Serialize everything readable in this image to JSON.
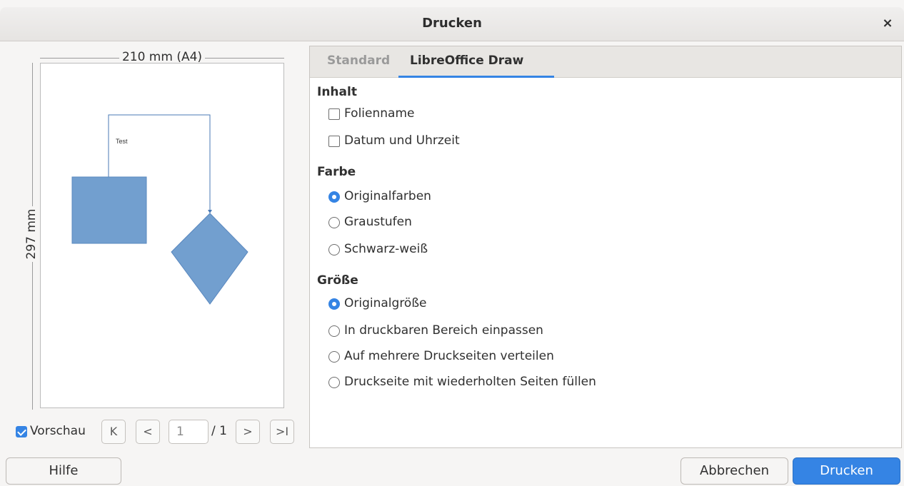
{
  "window": {
    "title": "Drucken",
    "close_glyph": "×"
  },
  "preview": {
    "width_label": "210 mm (A4)",
    "height_label": "297 mm",
    "drawing_text": "Test",
    "shape_color": "#729fcf",
    "preview_checkbox_label": "Vorschau",
    "preview_checked": true,
    "nav": {
      "first": "K",
      "prev": "<",
      "next": ">",
      "last": ">I"
    },
    "page_value": "1",
    "page_total": "/ 1"
  },
  "tabs": [
    {
      "label": "Standard",
      "active": false
    },
    {
      "label": "LibreOffice Draw",
      "active": true
    }
  ],
  "sections": {
    "inhalt": {
      "title": "Inhalt",
      "options": [
        {
          "label": "Folienname",
          "checked": false
        },
        {
          "label": "Datum und Uhrzeit",
          "checked": false
        }
      ]
    },
    "farbe": {
      "title": "Farbe",
      "options": [
        {
          "label": "Originalfarben",
          "selected": true
        },
        {
          "label": "Graustufen",
          "selected": false
        },
        {
          "label": "Schwarz-weiß",
          "selected": false
        }
      ]
    },
    "groesse": {
      "title": "Größe",
      "options": [
        {
          "label": "Originalgröße",
          "selected": true
        },
        {
          "label": "In druckbaren Bereich einpassen",
          "selected": false
        },
        {
          "label": "Auf mehrere Druckseiten verteilen",
          "selected": false
        },
        {
          "label": "Druckseite mit wiederholten Seiten füllen",
          "selected": false
        }
      ]
    }
  },
  "buttons": {
    "help": "Hilfe",
    "cancel": "Abbrechen",
    "print": "Drucken"
  },
  "colors": {
    "accent": "#3584e4"
  }
}
